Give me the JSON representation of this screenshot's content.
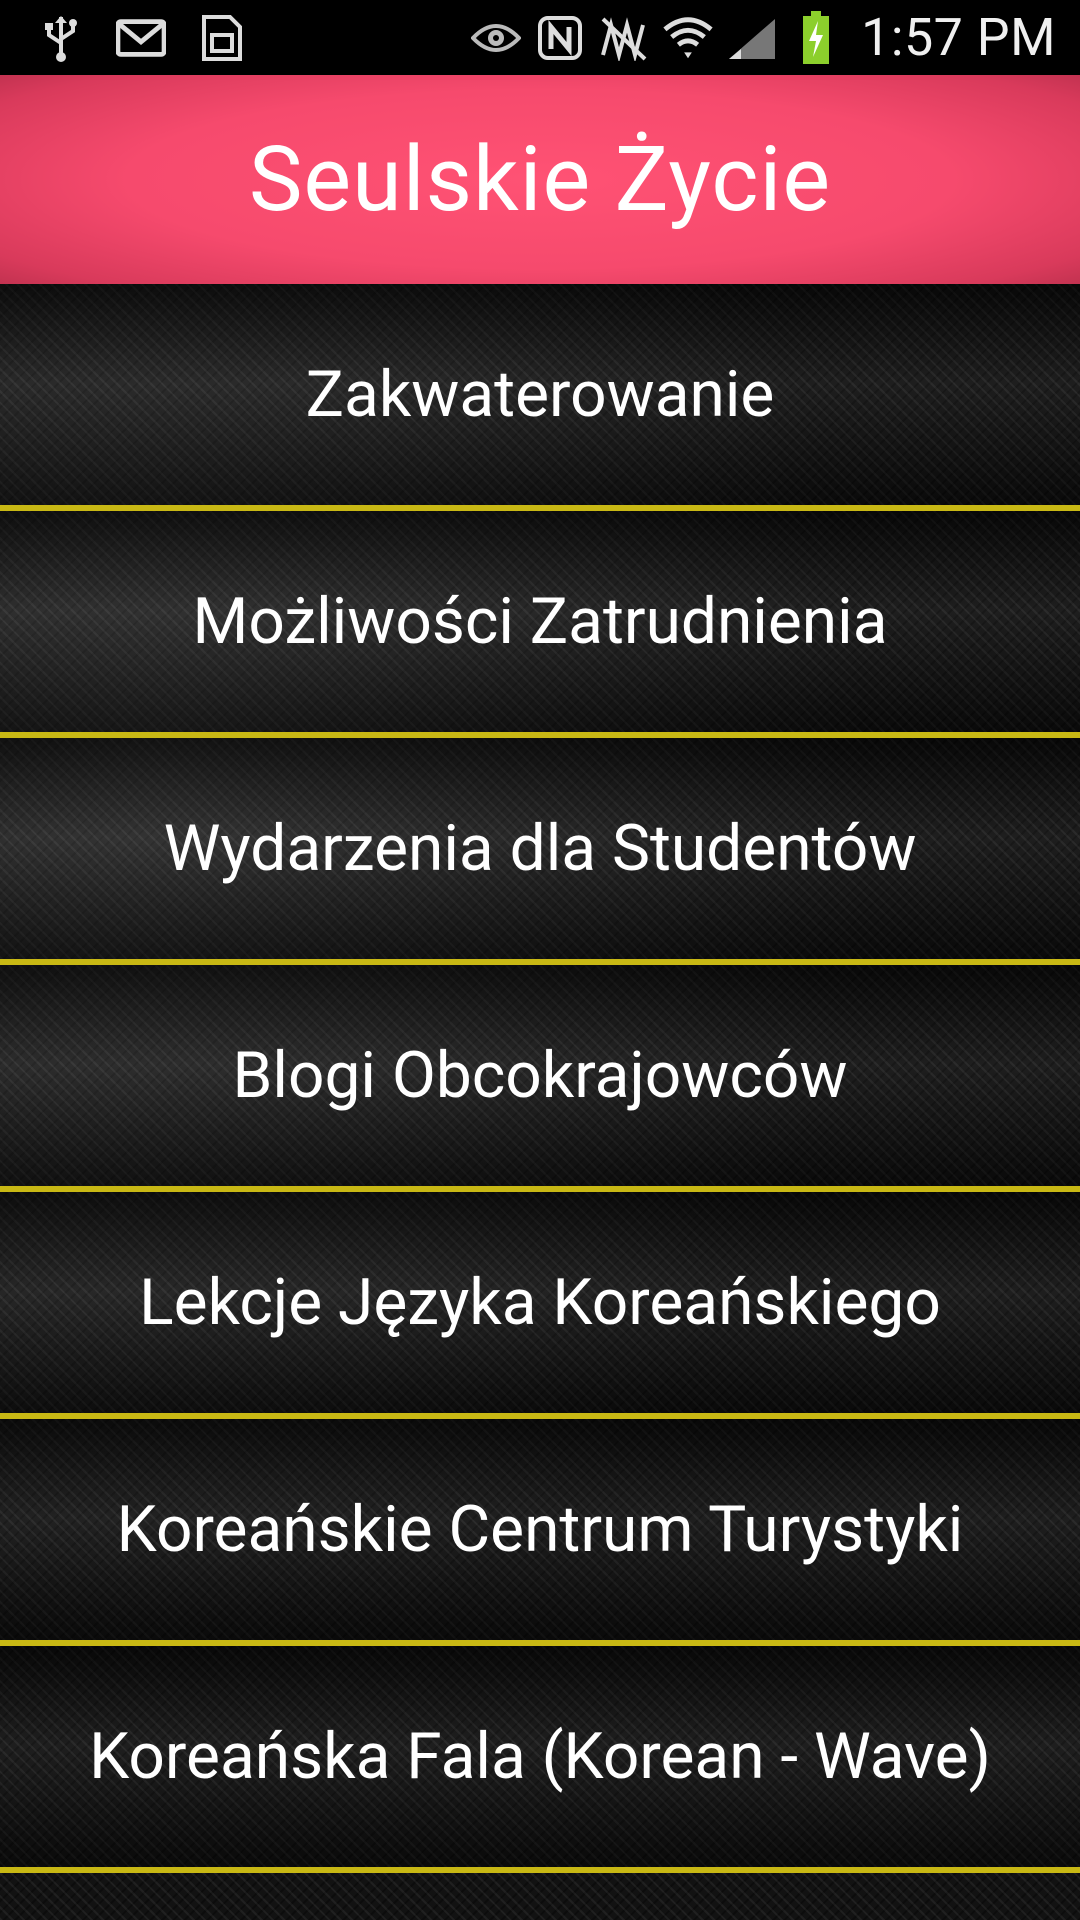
{
  "status_bar": {
    "time": "1:57 PM",
    "left_icons": [
      "usb-icon",
      "gmail-icon",
      "sd-card-icon"
    ],
    "right_icons": [
      "eye-icon",
      "nfc-icon",
      "mute-icon",
      "wifi-icon",
      "signal-icon",
      "battery-charging-icon"
    ]
  },
  "header": {
    "title": "Seulskie Życie",
    "background_color": "#f64a6d"
  },
  "menu": {
    "items": [
      {
        "label": "Zakwaterowanie"
      },
      {
        "label": "Możliwości Zatrudnienia"
      },
      {
        "label": "Wydarzenia dla Studentów"
      },
      {
        "label": "Blogi Obcokrajowców"
      },
      {
        "label": "Lekcje Języka Koreańskiego"
      },
      {
        "label": "Koreańskie Centrum Turystyki"
      },
      {
        "label": "Koreańska Fala (Korean - Wave)"
      }
    ],
    "divider_color": "#c8b814"
  }
}
